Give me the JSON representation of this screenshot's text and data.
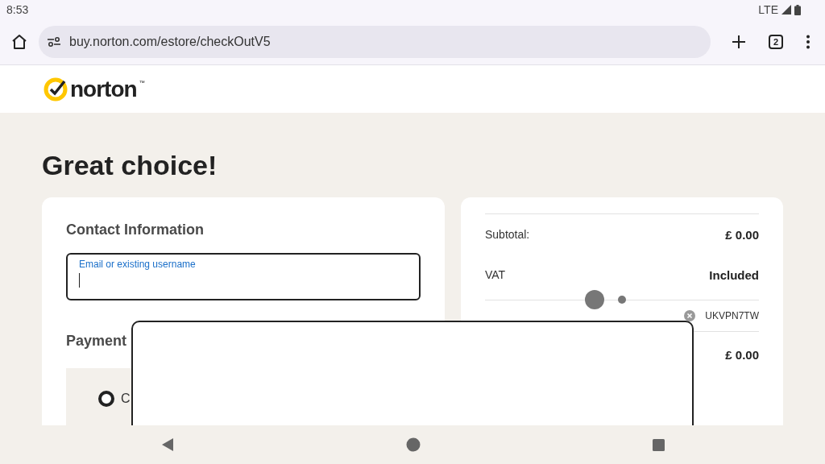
{
  "status_bar": {
    "time": "8:53",
    "network": "LTE"
  },
  "browser": {
    "url": "buy.norton.com/estore/checkOutV5",
    "tab_count": "2"
  },
  "brand": {
    "name": "norton",
    "mark": "™"
  },
  "heading": "Great choice!",
  "contact": {
    "title": "Contact Information",
    "email_label": "Email or existing username"
  },
  "payment": {
    "title": "Payment",
    "options": [
      {
        "label": "C",
        "selected": true
      }
    ]
  },
  "summary": {
    "rows": [
      {
        "kind": "line",
        "label": "Subtotal:",
        "value": "£ 0.00"
      },
      {
        "kind": "line",
        "label": "VAT",
        "value": "Included"
      },
      {
        "kind": "promo",
        "code": "UKVPN7TW"
      },
      {
        "kind": "total",
        "value": "£ 0.00"
      }
    ]
  }
}
